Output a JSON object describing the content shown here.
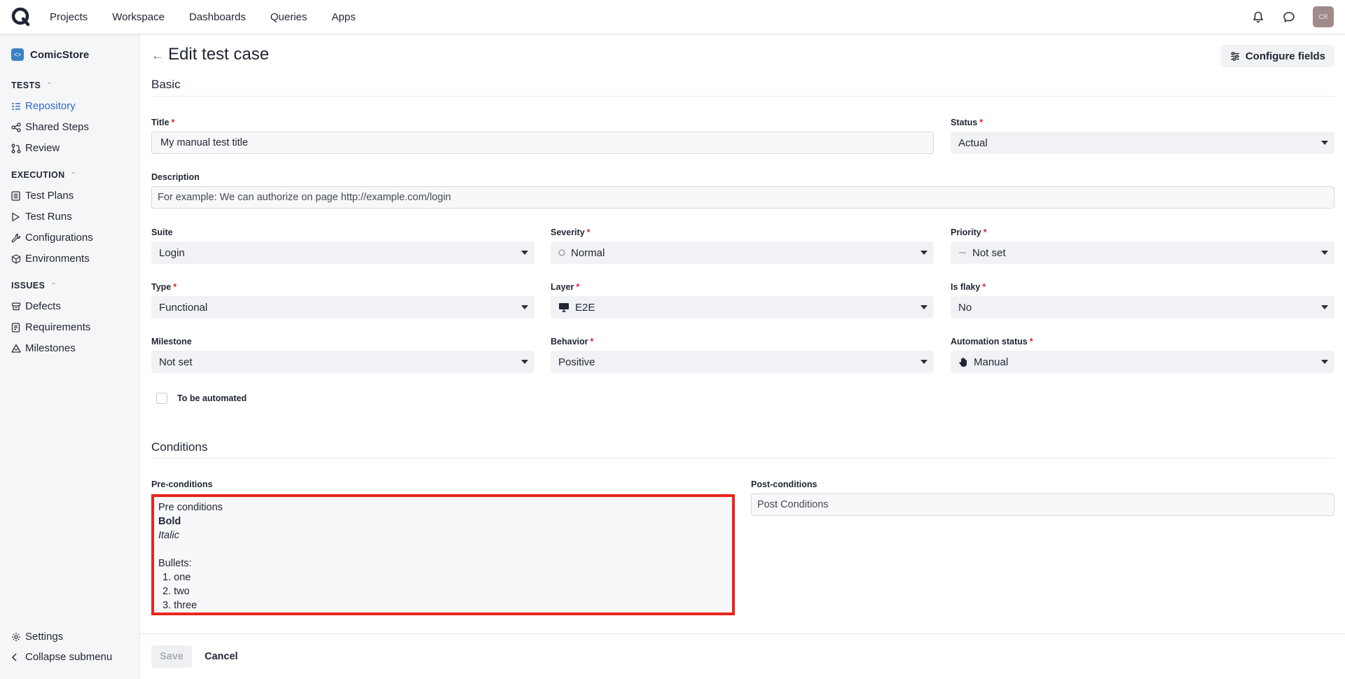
{
  "topnav": {
    "logo": "qase-logo",
    "links": [
      "Projects",
      "Workspace",
      "Dashboards",
      "Queries",
      "Apps"
    ],
    "avatar_initials": "CR"
  },
  "sidebar": {
    "project_icon": "<>",
    "project_name": "ComicStore",
    "tests_header": "TESTS",
    "tests_items": [
      "Repository",
      "Shared Steps",
      "Review"
    ],
    "execution_header": "EXECUTION",
    "execution_items": [
      "Test Plans",
      "Test Runs",
      "Configurations",
      "Environments"
    ],
    "issues_header": "ISSUES",
    "issues_items": [
      "Defects",
      "Requirements",
      "Milestones"
    ],
    "settings": "Settings",
    "collapse": "Collapse submenu",
    "active_item": "Repository",
    "accent_color": "#3567c7"
  },
  "page": {
    "title": "Edit test case",
    "configure_fields": "Configure fields",
    "basic_section": "Basic",
    "conditions_section": "Conditions"
  },
  "fields": {
    "title_label": "Title",
    "title_value": "My manual test title",
    "status_label": "Status",
    "status_value": "Actual",
    "description_label": "Description",
    "description_placeholder": "For example: We can authorize on page http://example.com/login",
    "suite_label": "Suite",
    "suite_value": "Login",
    "severity_label": "Severity",
    "severity_value": "Normal",
    "priority_label": "Priority",
    "priority_value": "Not set",
    "type_label": "Type",
    "type_value": "Functional",
    "layer_label": "Layer",
    "layer_value": "E2E",
    "flaky_label": "Is flaky",
    "flaky_value": "No",
    "milestone_label": "Milestone",
    "milestone_value": "Not set",
    "behavior_label": "Behavior",
    "behavior_value": "Positive",
    "automation_label": "Automation status",
    "automation_value": "Manual",
    "to_be_automated": "To be automated",
    "required_mark": "*"
  },
  "conditions": {
    "pre_label": "Pre-conditions",
    "pre_line1": "Pre conditions",
    "pre_bold": "Bold",
    "pre_italic": "Italic",
    "pre_bullets_title": "Bullets:",
    "pre_list": [
      "one",
      "two",
      "three"
    ],
    "post_label": "Post-conditions",
    "post_value": "Post Conditions",
    "highlight_color": "#e8261c"
  },
  "footer": {
    "save": "Save",
    "cancel": "Cancel"
  }
}
